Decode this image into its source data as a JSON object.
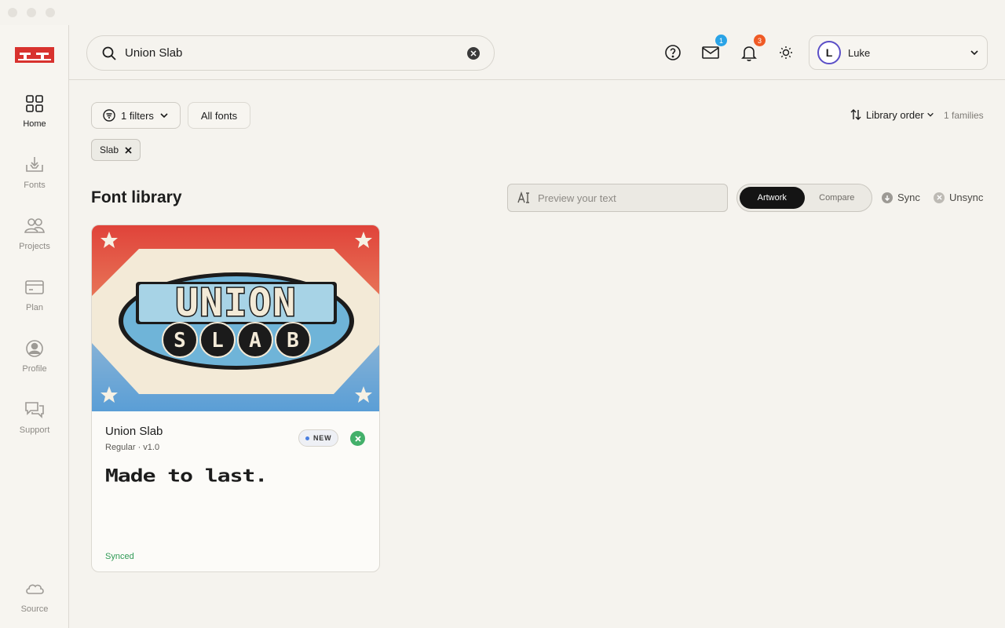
{
  "sidebar": {
    "items": [
      {
        "label": "Home",
        "icon": "grid-icon",
        "active": true
      },
      {
        "label": "Fonts",
        "icon": "download-tray-icon"
      },
      {
        "label": "Projects",
        "icon": "people-icon"
      },
      {
        "label": "Plan",
        "icon": "credit-card-icon"
      },
      {
        "label": "Profile",
        "icon": "user-circle-icon"
      },
      {
        "label": "Support",
        "icon": "chat-bubbles-icon"
      }
    ],
    "bottom": {
      "label": "Source",
      "icon": "cloud-icon"
    }
  },
  "header": {
    "search_value": "Union Slab",
    "mail_badge": "1",
    "notifications_badge": "3",
    "user": {
      "initial": "L",
      "name": "Luke"
    }
  },
  "filters": {
    "filters_label": "1 filters",
    "all_fonts_label": "All fonts",
    "sort_label": "Library order",
    "count": "1 families",
    "active_chip": "Slab"
  },
  "library": {
    "title": "Font library",
    "preview_placeholder": "Preview your text",
    "toggle": [
      "Artwork",
      "Compare"
    ],
    "sync_label": "Sync",
    "unsync_label": "Unsync"
  },
  "card": {
    "name": "Union Slab",
    "meta": "Regular · v1.0",
    "badge": "NEW",
    "sample": "Made to last.",
    "status": "Synced",
    "art_line1": "UNION",
    "art_line2": [
      "S",
      "L",
      "A",
      "B"
    ]
  },
  "colors": {
    "accent_red": "#e0433a",
    "accent_blue": "#5a9ed6",
    "mail_badge": "#2aa3e6",
    "notify_badge": "#ef5a25",
    "synced_green": "#2f9a55"
  }
}
